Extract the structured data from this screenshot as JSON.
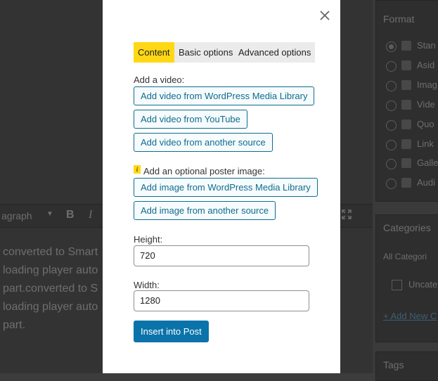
{
  "background": {
    "toolbar": {
      "block_type": "agraph"
    },
    "editor_lines": [
      "converted to Smart",
      "loading player auto",
      "part.converted to S",
      "loading player auto",
      "part."
    ],
    "sidebar": {
      "format_title": "Format",
      "format_options": [
        "Stan",
        "Asid",
        "Imag",
        "Vide",
        "Quo",
        "Link",
        "Galle",
        "Audi"
      ],
      "categories_title": "Categories",
      "categories_tab": "All Categori",
      "category_item": "Uncate",
      "add_new_category": "+ Add New C",
      "tags_title": "Tags"
    }
  },
  "modal": {
    "tabs": [
      "Content",
      "Basic options",
      "Advanced options"
    ],
    "active_tab": "Content",
    "video_label": "Add a video:",
    "video_buttons": [
      "Add video from WordPress Media Library",
      "Add video from YouTube",
      "Add video from another source"
    ],
    "poster_label": "Add an optional poster image:",
    "poster_info_mark": "i",
    "poster_buttons": [
      "Add image from WordPress Media Library",
      "Add image from another source"
    ],
    "height_label": "Height:",
    "height_value": "720",
    "width_label": "Width:",
    "width_value": "1280",
    "insert_button": "Insert into Post"
  },
  "colors": {
    "active_tab": "#ffd815",
    "primary": "#0a73aa",
    "link_button": "#0f6c8d"
  },
  "icons": {
    "close": "close-icon",
    "expand": "expand-icon",
    "info": "info-icon"
  }
}
